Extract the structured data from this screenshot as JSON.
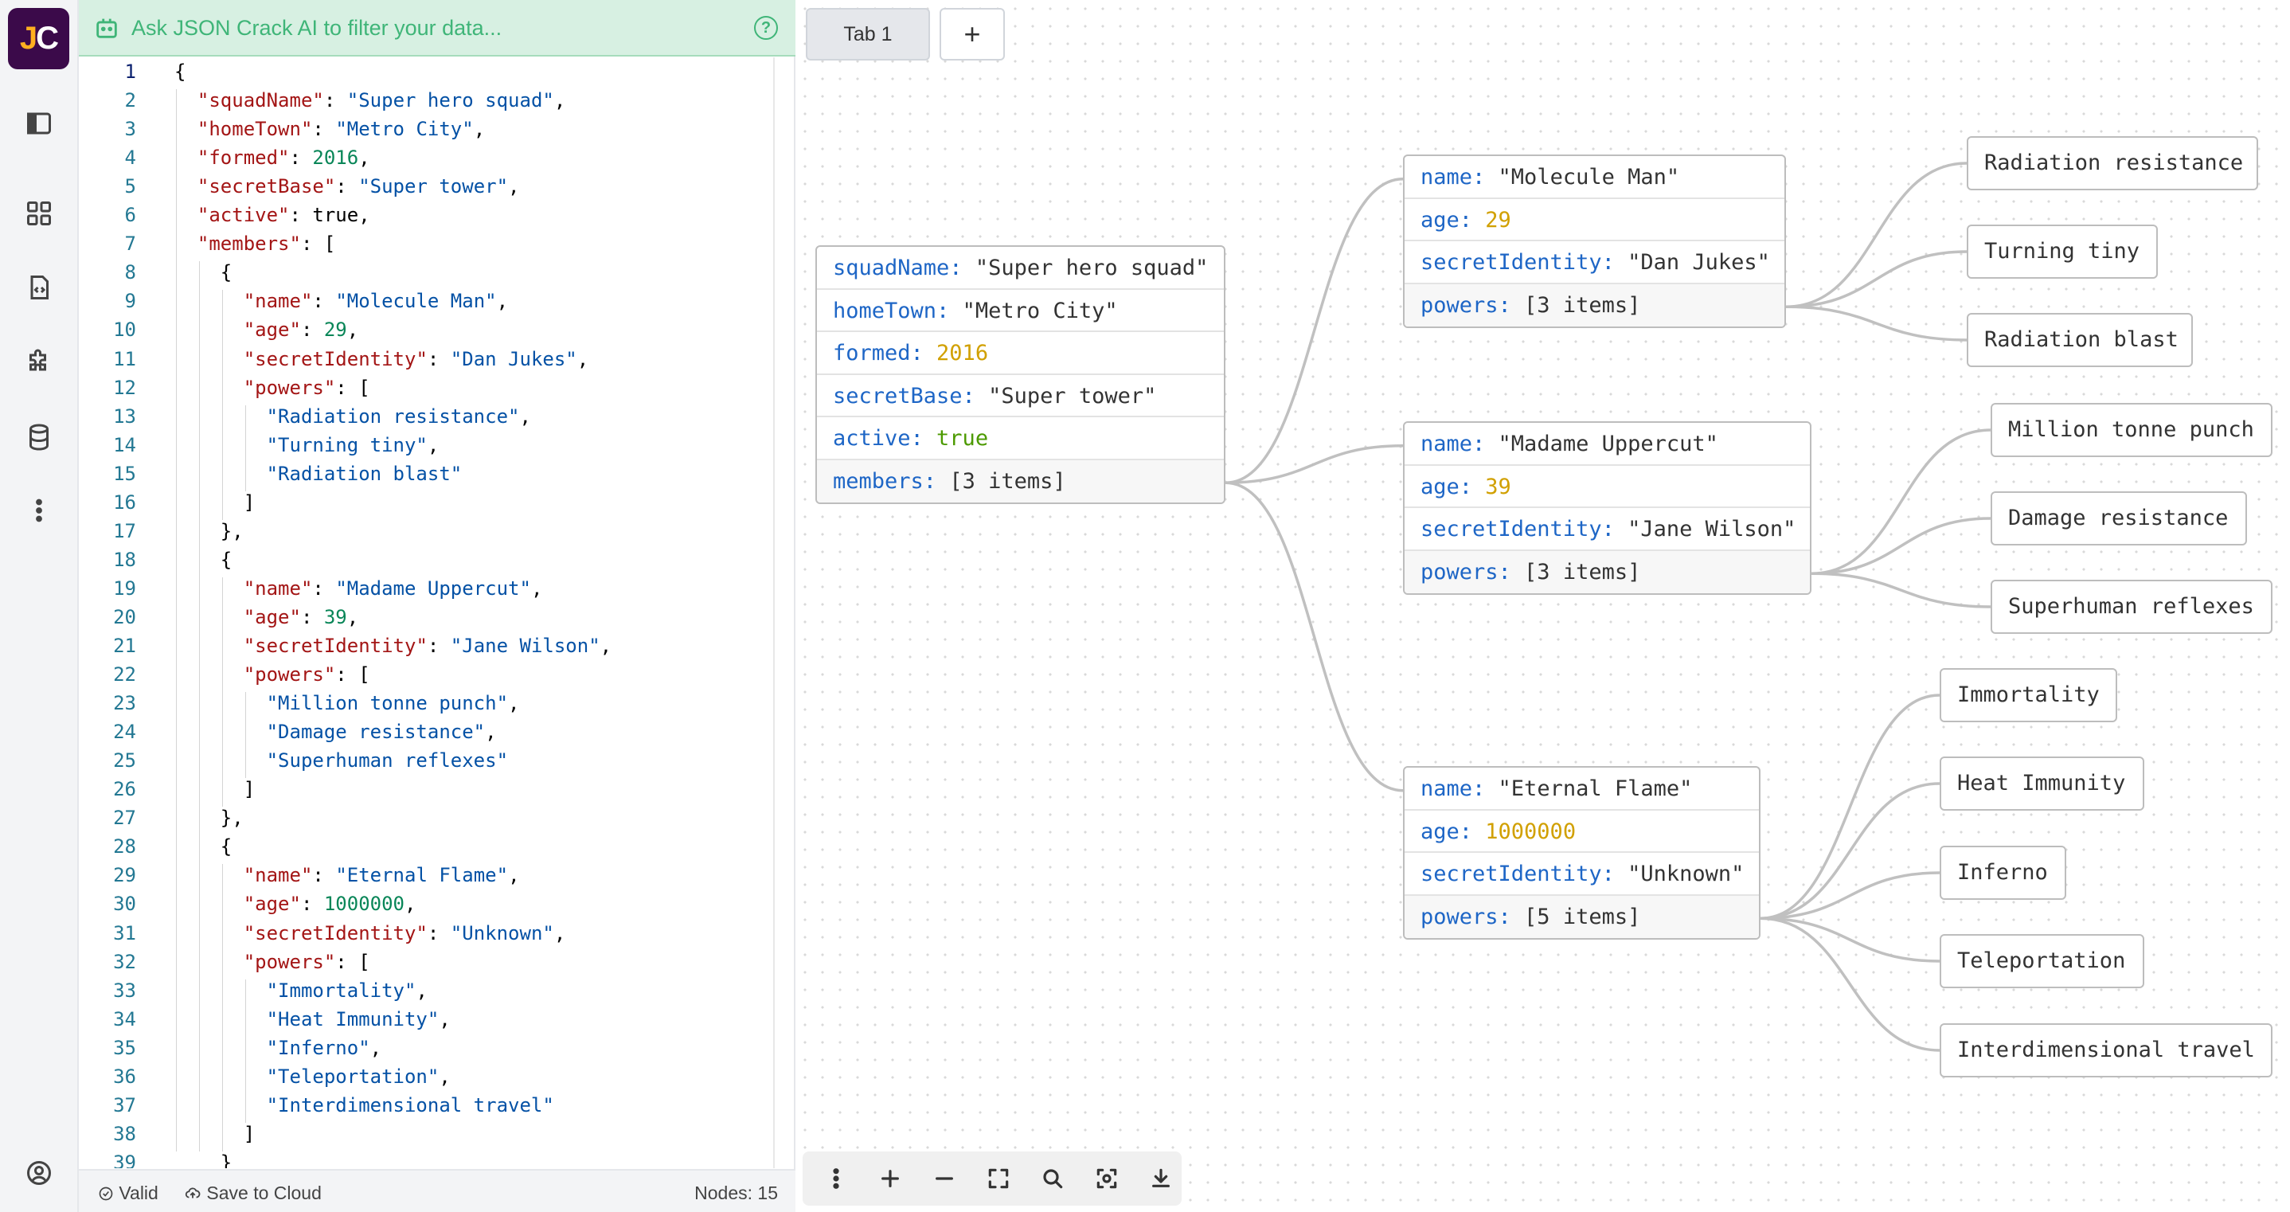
{
  "ai_bar": {
    "placeholder": "Ask JSON Crack AI to filter your data..."
  },
  "logo": {
    "text_j": "J",
    "text_c": "C"
  },
  "rail_icons": [
    "sidebar-icon",
    "grid-icon",
    "file-code-icon",
    "puzzle-icon",
    "database-icon",
    "more-vertical-icon",
    "user-circle-icon"
  ],
  "code_lines": [
    "{",
    "  \"squadName\": \"Super hero squad\",",
    "  \"homeTown\": \"Metro City\",",
    "  \"formed\": 2016,",
    "  \"secretBase\": \"Super tower\",",
    "  \"active\": true,",
    "  \"members\": [",
    "    {",
    "      \"name\": \"Molecule Man\",",
    "      \"age\": 29,",
    "      \"secretIdentity\": \"Dan Jukes\",",
    "      \"powers\": [",
    "        \"Radiation resistance\",",
    "        \"Turning tiny\",",
    "        \"Radiation blast\"",
    "      ]",
    "    },",
    "    {",
    "      \"name\": \"Madame Uppercut\",",
    "      \"age\": 39,",
    "      \"secretIdentity\": \"Jane Wilson\",",
    "      \"powers\": [",
    "        \"Million tonne punch\",",
    "        \"Damage resistance\",",
    "        \"Superhuman reflexes\"",
    "      ]",
    "    },",
    "    {",
    "      \"name\": \"Eternal Flame\",",
    "      \"age\": 1000000,",
    "      \"secretIdentity\": \"Unknown\",",
    "      \"powers\": [",
    "        \"Immortality\",",
    "        \"Heat Immunity\",",
    "        \"Inferno\",",
    "        \"Teleportation\",",
    "        \"Interdimensional travel\"",
    "      ]",
    "    }"
  ],
  "status": {
    "valid": "Valid",
    "save": "Save to Cloud",
    "nodes": "Nodes: 15"
  },
  "tabs": {
    "tab1": "Tab 1",
    "add": "+"
  },
  "graph": {
    "root": [
      {
        "k": "squadName",
        "v": "\"Super hero squad\"",
        "t": "str"
      },
      {
        "k": "homeTown",
        "v": "\"Metro City\"",
        "t": "str"
      },
      {
        "k": "formed",
        "v": "2016",
        "t": "num"
      },
      {
        "k": "secretBase",
        "v": "\"Super tower\"",
        "t": "str"
      },
      {
        "k": "active",
        "v": "true",
        "t": "bool"
      },
      {
        "k": "members",
        "v": "[3 items]",
        "t": "arr"
      }
    ],
    "members": [
      {
        "rows": [
          {
            "k": "name",
            "v": "\"Molecule Man\"",
            "t": "str"
          },
          {
            "k": "age",
            "v": "29",
            "t": "num"
          },
          {
            "k": "secretIdentity",
            "v": "\"Dan Jukes\"",
            "t": "str"
          },
          {
            "k": "powers",
            "v": "[3 items]",
            "t": "arr"
          }
        ],
        "powers": [
          "Radiation resistance",
          "Turning tiny",
          "Radiation blast"
        ]
      },
      {
        "rows": [
          {
            "k": "name",
            "v": "\"Madame Uppercut\"",
            "t": "str"
          },
          {
            "k": "age",
            "v": "39",
            "t": "num"
          },
          {
            "k": "secretIdentity",
            "v": "\"Jane Wilson\"",
            "t": "str"
          },
          {
            "k": "powers",
            "v": "[3 items]",
            "t": "arr"
          }
        ],
        "powers": [
          "Million tonne punch",
          "Damage resistance",
          "Superhuman reflexes"
        ]
      },
      {
        "rows": [
          {
            "k": "name",
            "v": "\"Eternal Flame\"",
            "t": "str"
          },
          {
            "k": "age",
            "v": "1000000",
            "t": "num"
          },
          {
            "k": "secretIdentity",
            "v": "\"Unknown\"",
            "t": "str"
          },
          {
            "k": "powers",
            "v": "[5 items]",
            "t": "arr"
          }
        ],
        "powers": [
          "Immortality",
          "Heat Immunity",
          "Inferno",
          "Teleportation",
          "Interdimensional travel"
        ]
      }
    ]
  },
  "toolbar_icons": [
    "more-vertical-icon",
    "zoom-in-icon",
    "zoom-out-icon",
    "fit-screen-icon",
    "search-icon",
    "focus-icon",
    "download-icon"
  ]
}
